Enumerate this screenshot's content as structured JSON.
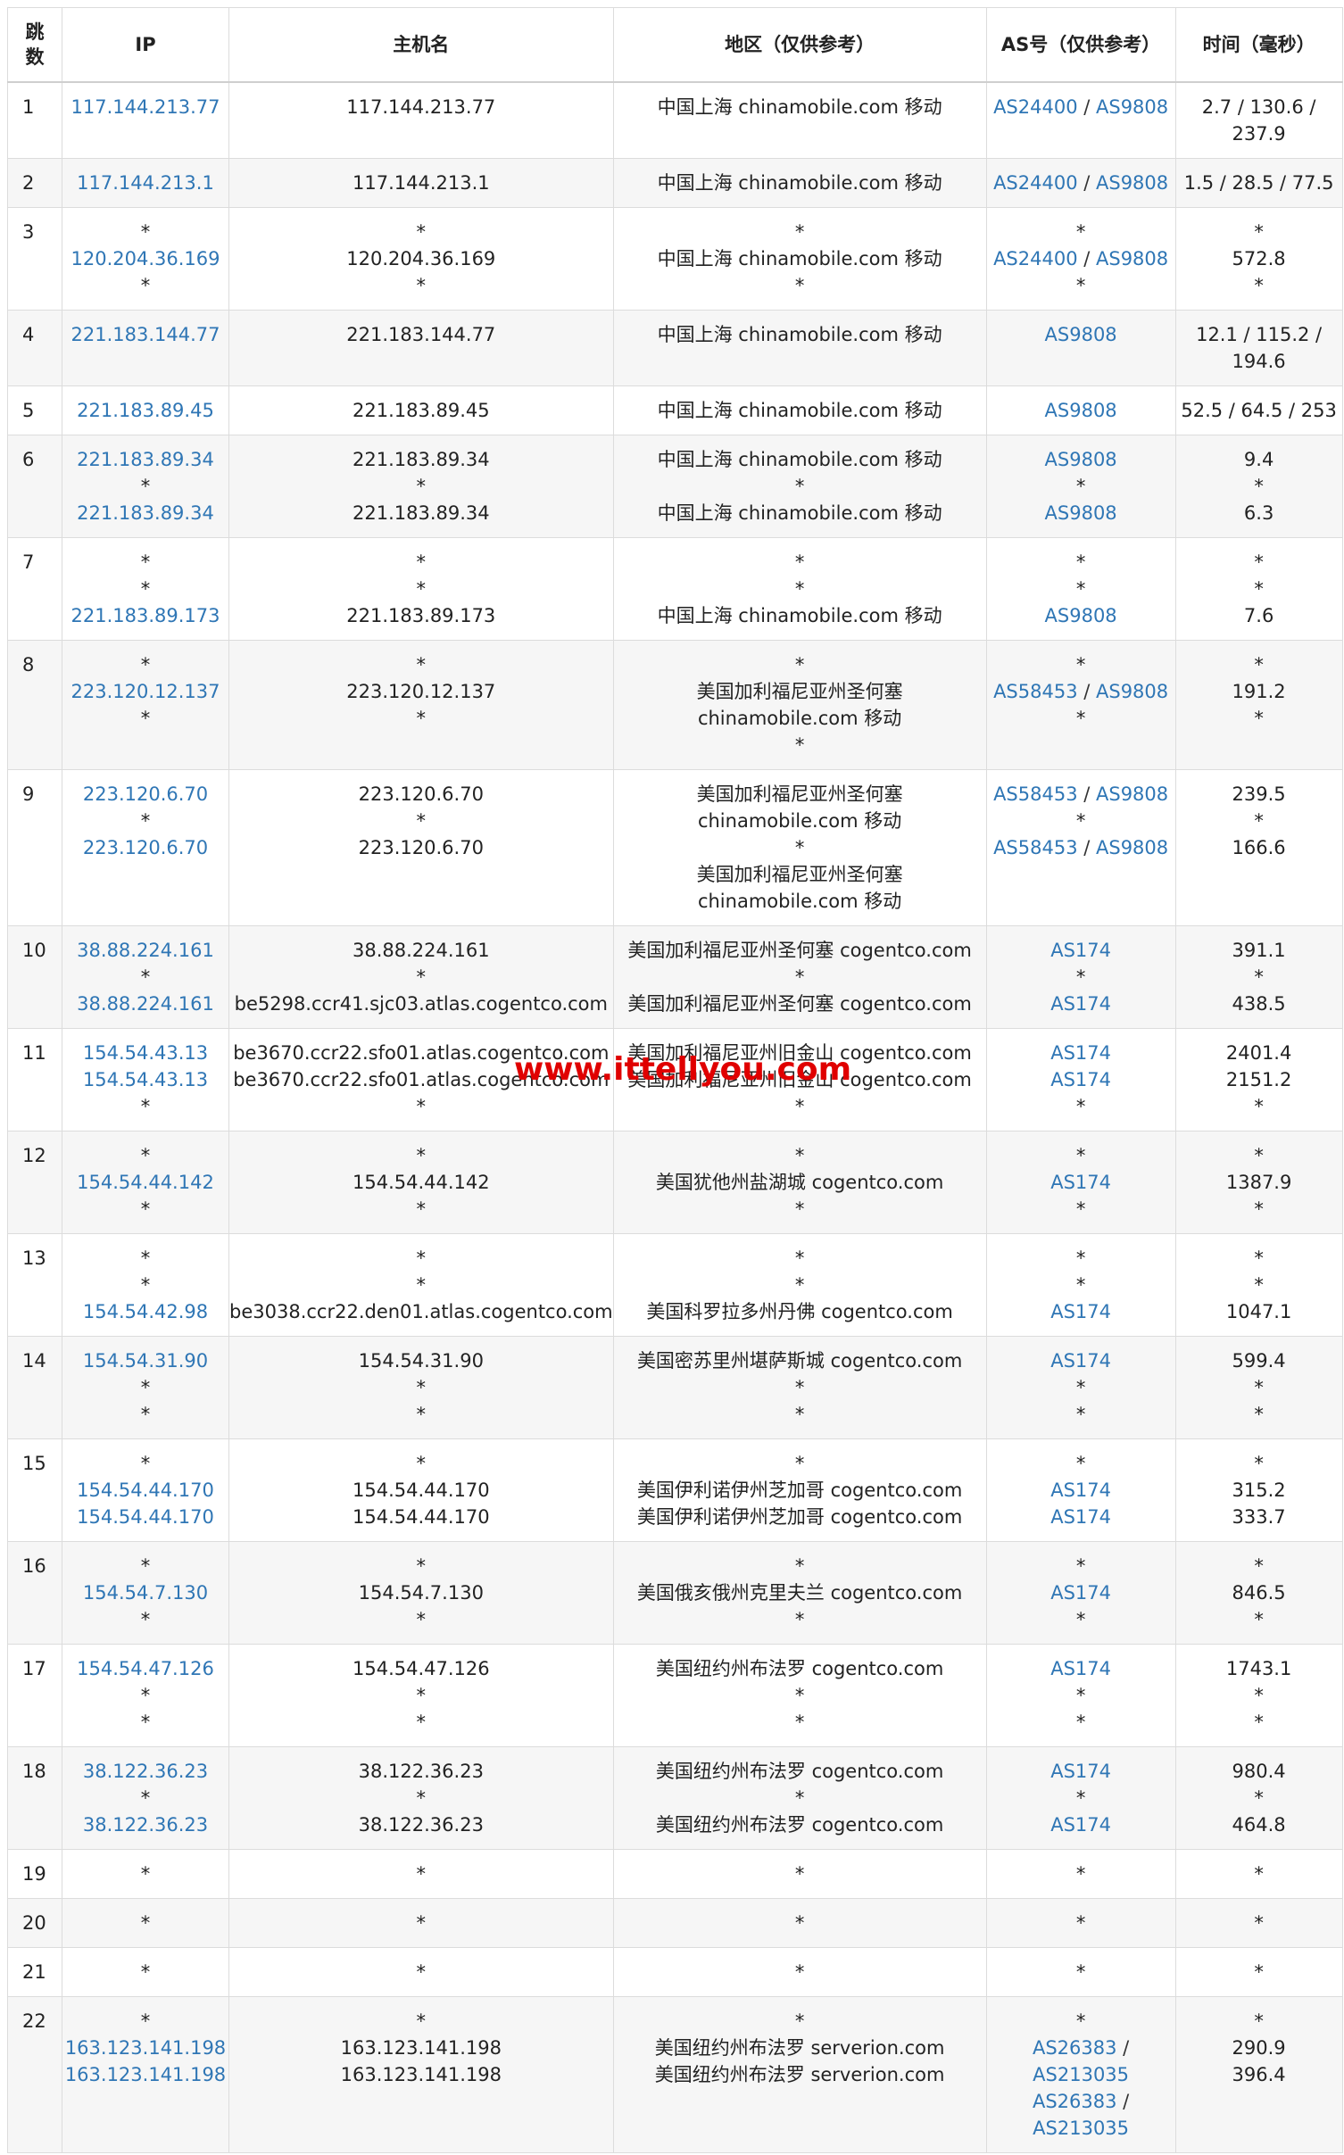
{
  "watermark": "www.ittellyou.com",
  "colors": {
    "link": "#2f76b5",
    "watermark": "#e00000",
    "border": "#dcdcdc",
    "stripe": "#f6f6f6"
  },
  "headers": {
    "hop": "跳数",
    "ip": "IP",
    "host": "主机名",
    "region": "地区（仅供参考）",
    "as": "AS号（仅供参考）",
    "time": "时间（毫秒）"
  },
  "rows": [
    {
      "hop": "1",
      "ip": [
        "117.144.213.77"
      ],
      "host": [
        "117.144.213.77"
      ],
      "region": [
        "中国上海 chinamobile.com 移动"
      ],
      "as": [
        [
          "AS24400",
          "AS9808"
        ]
      ],
      "time": [
        "2.7 / 130.6 /",
        "237.9"
      ]
    },
    {
      "hop": "2",
      "ip": [
        "117.144.213.1"
      ],
      "host": [
        "117.144.213.1"
      ],
      "region": [
        "中国上海 chinamobile.com 移动"
      ],
      "as": [
        [
          "AS24400",
          "AS9808"
        ]
      ],
      "time": [
        "1.5 / 28.5 / 77.5"
      ]
    },
    {
      "hop": "3",
      "ip": [
        "*",
        "120.204.36.169",
        "*"
      ],
      "host": [
        "*",
        "120.204.36.169",
        "*"
      ],
      "region": [
        "*",
        "中国上海 chinamobile.com 移动",
        "*"
      ],
      "as": [
        "*",
        [
          "AS24400",
          "AS9808"
        ],
        "*"
      ],
      "time": [
        "*",
        "572.8",
        "*"
      ]
    },
    {
      "hop": "4",
      "ip": [
        "221.183.144.77"
      ],
      "host": [
        "221.183.144.77"
      ],
      "region": [
        "中国上海 chinamobile.com 移动"
      ],
      "as": [
        [
          "AS9808"
        ]
      ],
      "time": [
        "12.1 / 115.2 /",
        "194.6"
      ]
    },
    {
      "hop": "5",
      "ip": [
        "221.183.89.45"
      ],
      "host": [
        "221.183.89.45"
      ],
      "region": [
        "中国上海 chinamobile.com 移动"
      ],
      "as": [
        [
          "AS9808"
        ]
      ],
      "time": [
        "52.5 / 64.5 / 253"
      ]
    },
    {
      "hop": "6",
      "ip": [
        "221.183.89.34",
        "*",
        "221.183.89.34"
      ],
      "host": [
        "221.183.89.34",
        "*",
        "221.183.89.34"
      ],
      "region": [
        "中国上海 chinamobile.com 移动",
        "*",
        "中国上海 chinamobile.com 移动"
      ],
      "as": [
        [
          "AS9808"
        ],
        "*",
        [
          "AS9808"
        ]
      ],
      "time": [
        "9.4",
        "*",
        "6.3"
      ]
    },
    {
      "hop": "7",
      "ip": [
        "*",
        "*",
        "221.183.89.173"
      ],
      "host": [
        "*",
        "*",
        "221.183.89.173"
      ],
      "region": [
        "*",
        "*",
        "中国上海 chinamobile.com 移动"
      ],
      "as": [
        "*",
        "*",
        [
          "AS9808"
        ]
      ],
      "time": [
        "*",
        "*",
        "7.6"
      ]
    },
    {
      "hop": "8",
      "ip": [
        "*",
        "223.120.12.137",
        "*"
      ],
      "host": [
        "*",
        "223.120.12.137",
        "*"
      ],
      "region": [
        "*",
        "美国加利福尼亚州圣何塞",
        "chinamobile.com 移动",
        "*"
      ],
      "as": [
        "*",
        [
          "AS58453",
          "AS9808"
        ],
        "*"
      ],
      "time": [
        "*",
        "191.2",
        "*"
      ]
    },
    {
      "hop": "9",
      "ip": [
        "223.120.6.70",
        "*",
        "223.120.6.70"
      ],
      "host": [
        "223.120.6.70",
        "*",
        "223.120.6.70"
      ],
      "region": [
        "美国加利福尼亚州圣何塞",
        "chinamobile.com 移动",
        "*",
        "美国加利福尼亚州圣何塞",
        "chinamobile.com 移动"
      ],
      "as": [
        [
          "AS58453",
          "AS9808"
        ],
        "*",
        [
          "AS58453",
          "AS9808"
        ]
      ],
      "time": [
        "239.5",
        "*",
        "166.6"
      ]
    },
    {
      "hop": "10",
      "ip": [
        "38.88.224.161",
        "*",
        "38.88.224.161"
      ],
      "host": [
        "38.88.224.161",
        "*",
        "be5298.ccr41.sjc03.atlas.cogentco.com"
      ],
      "region": [
        "美国加利福尼亚州圣何塞 cogentco.com",
        "*",
        "美国加利福尼亚州圣何塞 cogentco.com"
      ],
      "as": [
        [
          "AS174"
        ],
        "*",
        [
          "AS174"
        ]
      ],
      "time": [
        "391.1",
        "*",
        "438.5"
      ]
    },
    {
      "hop": "11",
      "ip": [
        "154.54.43.13",
        "154.54.43.13",
        "*"
      ],
      "host": [
        "be3670.ccr22.sfo01.atlas.cogentco.com",
        "be3670.ccr22.sfo01.atlas.cogentco.com",
        "*"
      ],
      "region": [
        "美国加利福尼亚州旧金山 cogentco.com",
        "美国加利福尼亚州旧金山 cogentco.com",
        "*"
      ],
      "as": [
        [
          "AS174"
        ],
        [
          "AS174"
        ],
        "*"
      ],
      "time": [
        "2401.4",
        "2151.2",
        "*"
      ]
    },
    {
      "hop": "12",
      "ip": [
        "*",
        "154.54.44.142",
        "*"
      ],
      "host": [
        "*",
        "154.54.44.142",
        "*"
      ],
      "region": [
        "*",
        "美国犹他州盐湖城 cogentco.com",
        "*"
      ],
      "as": [
        "*",
        [
          "AS174"
        ],
        "*"
      ],
      "time": [
        "*",
        "1387.9",
        "*"
      ]
    },
    {
      "hop": "13",
      "ip": [
        "*",
        "*",
        "154.54.42.98"
      ],
      "host": [
        "*",
        "*",
        "be3038.ccr22.den01.atlas.cogentco.com"
      ],
      "region": [
        "*",
        "*",
        "美国科罗拉多州丹佛 cogentco.com"
      ],
      "as": [
        "*",
        "*",
        [
          "AS174"
        ]
      ],
      "time": [
        "*",
        "*",
        "1047.1"
      ]
    },
    {
      "hop": "14",
      "ip": [
        "154.54.31.90",
        "*",
        "*"
      ],
      "host": [
        "154.54.31.90",
        "*",
        "*"
      ],
      "region": [
        "美国密苏里州堪萨斯城 cogentco.com",
        "*",
        "*"
      ],
      "as": [
        [
          "AS174"
        ],
        "*",
        "*"
      ],
      "time": [
        "599.4",
        "*",
        "*"
      ]
    },
    {
      "hop": "15",
      "ip": [
        "*",
        "154.54.44.170",
        "154.54.44.170"
      ],
      "host": [
        "*",
        "154.54.44.170",
        "154.54.44.170"
      ],
      "region": [
        "*",
        "美国伊利诺伊州芝加哥 cogentco.com",
        "美国伊利诺伊州芝加哥 cogentco.com"
      ],
      "as": [
        "*",
        [
          "AS174"
        ],
        [
          "AS174"
        ]
      ],
      "time": [
        "*",
        "315.2",
        "333.7"
      ]
    },
    {
      "hop": "16",
      "ip": [
        "*",
        "154.54.7.130",
        "*"
      ],
      "host": [
        "*",
        "154.54.7.130",
        "*"
      ],
      "region": [
        "*",
        "美国俄亥俄州克里夫兰 cogentco.com",
        "*"
      ],
      "as": [
        "*",
        [
          "AS174"
        ],
        "*"
      ],
      "time": [
        "*",
        "846.5",
        "*"
      ]
    },
    {
      "hop": "17",
      "ip": [
        "154.54.47.126",
        "*",
        "*"
      ],
      "host": [
        "154.54.47.126",
        "*",
        "*"
      ],
      "region": [
        "美国纽约州布法罗 cogentco.com",
        "*",
        "*"
      ],
      "as": [
        [
          "AS174"
        ],
        "*",
        "*"
      ],
      "time": [
        "1743.1",
        "*",
        "*"
      ]
    },
    {
      "hop": "18",
      "ip": [
        "38.122.36.23",
        "*",
        "38.122.36.23"
      ],
      "host": [
        "38.122.36.23",
        "*",
        "38.122.36.23"
      ],
      "region": [
        "美国纽约州布法罗 cogentco.com",
        "*",
        "美国纽约州布法罗 cogentco.com"
      ],
      "as": [
        [
          "AS174"
        ],
        "*",
        [
          "AS174"
        ]
      ],
      "time": [
        "980.4",
        "*",
        "464.8"
      ]
    },
    {
      "hop": "19",
      "ip": [
        "*"
      ],
      "host": [
        "*"
      ],
      "region": [
        "*"
      ],
      "as": [
        "*"
      ],
      "time": [
        "*"
      ]
    },
    {
      "hop": "20",
      "ip": [
        "*"
      ],
      "host": [
        "*"
      ],
      "region": [
        "*"
      ],
      "as": [
        "*"
      ],
      "time": [
        "*"
      ]
    },
    {
      "hop": "21",
      "ip": [
        "*"
      ],
      "host": [
        "*"
      ],
      "region": [
        "*"
      ],
      "as": [
        "*"
      ],
      "time": [
        "*"
      ]
    },
    {
      "hop": "22",
      "ip": [
        "*",
        "163.123.141.198",
        "163.123.141.198"
      ],
      "host": [
        "*",
        "163.123.141.198",
        "163.123.141.198"
      ],
      "region": [
        "*",
        "美国纽约州布法罗 serverion.com",
        "美国纽约州布法罗 serverion.com"
      ],
      "as": [
        "*",
        [
          "AS26383",
          "AS213035"
        ],
        [
          "AS26383",
          "AS213035"
        ]
      ],
      "as_wrapped": true,
      "time": [
        "*",
        "290.9",
        "396.4"
      ]
    }
  ]
}
